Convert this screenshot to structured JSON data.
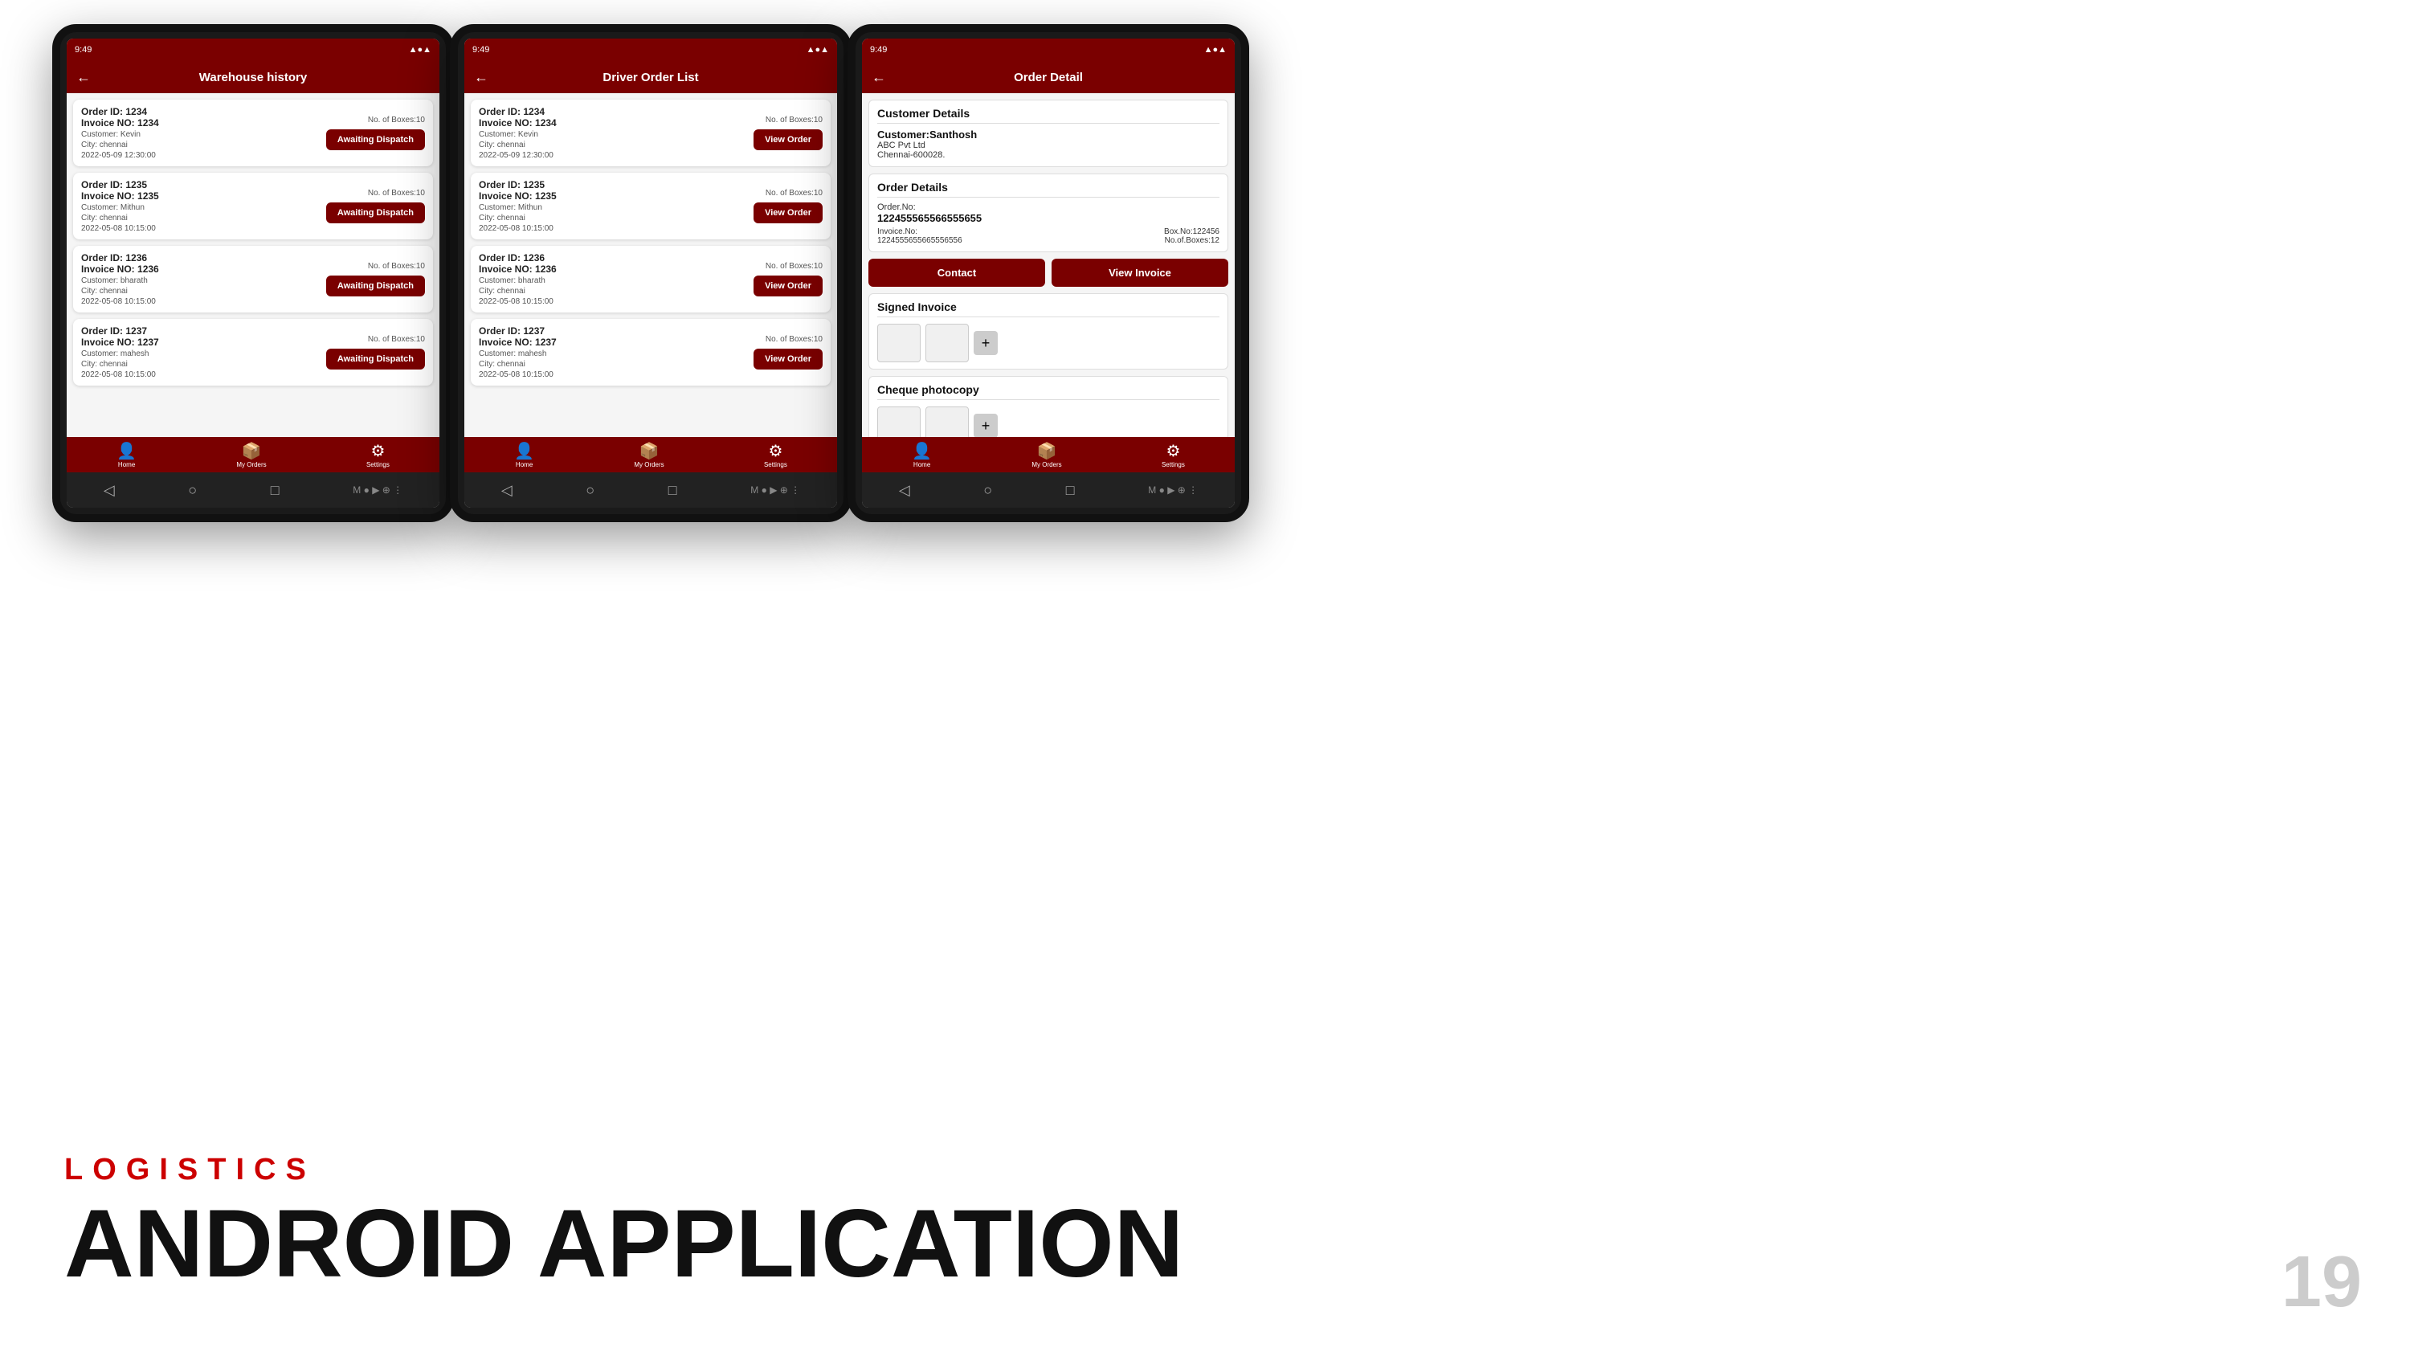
{
  "page": {
    "title": "LOGISTICS",
    "subtitle": "ANDROID APPLICATION",
    "page_number": "19"
  },
  "tablet1": {
    "header_title": "Warehouse history",
    "status_time": "9:49",
    "orders": [
      {
        "order_id": "Order ID: 1234",
        "invoice_no": "Invoice NO: 1234",
        "customer": "Customer: Kevin",
        "city": "City: chennai",
        "date": "2022-05-09 12:30:00",
        "boxes": "No. of Boxes:10",
        "btn_label": "Awaiting Dispatch"
      },
      {
        "order_id": "Order ID: 1235",
        "invoice_no": "Invoice NO: 1235",
        "customer": "Customer: Mithun",
        "city": "City: chennai",
        "date": "2022-05-08 10:15:00",
        "boxes": "No. of Boxes:10",
        "btn_label": "Awaiting Dispatch"
      },
      {
        "order_id": "Order ID: 1236",
        "invoice_no": "Invoice NO: 1236",
        "customer": "Customer: bharath",
        "city": "City: chennai",
        "date": "2022-05-08 10:15:00",
        "boxes": "No. of Boxes:10",
        "btn_label": "Awaiting Dispatch"
      },
      {
        "order_id": "Order ID: 1237",
        "invoice_no": "Invoice NO: 1237",
        "customer": "Customer: mahesh",
        "city": "City: chennai",
        "date": "2022-05-08 10:15:00",
        "boxes": "No. of Boxes:10",
        "btn_label": "Awaiting Dispatch"
      }
    ],
    "nav": [
      {
        "label": "Home",
        "icon": "👤"
      },
      {
        "label": "My Orders",
        "icon": "📦"
      },
      {
        "label": "Settings",
        "icon": "⚙"
      }
    ]
  },
  "tablet2": {
    "header_title": "Driver Order List",
    "status_time": "9:49",
    "orders": [
      {
        "order_id": "Order ID: 1234",
        "invoice_no": "Invoice NO: 1234",
        "customer": "Customer: Kevin",
        "city": "City: chennai",
        "date": "2022-05-09 12:30:00",
        "boxes": "No. of Boxes:10",
        "btn_label": "View Order"
      },
      {
        "order_id": "Order ID: 1235",
        "invoice_no": "Invoice NO: 1235",
        "customer": "Customer: Mithun",
        "city": "City: chennai",
        "date": "2022-05-08 10:15:00",
        "boxes": "No. of Boxes:10",
        "btn_label": "View Order"
      },
      {
        "order_id": "Order ID: 1236",
        "invoice_no": "Invoice NO: 1236",
        "customer": "Customer: bharath",
        "city": "City: chennai",
        "date": "2022-05-08 10:15:00",
        "boxes": "No. of Boxes:10",
        "btn_label": "View Order"
      },
      {
        "order_id": "Order ID: 1237",
        "invoice_no": "Invoice NO: 1237",
        "customer": "Customer: mahesh",
        "city": "City: chennai",
        "date": "2022-05-08 10:15:00",
        "boxes": "No. of Boxes:10",
        "btn_label": "View Order"
      }
    ],
    "nav": [
      {
        "label": "Home",
        "icon": "👤"
      },
      {
        "label": "My Orders",
        "icon": "📦"
      },
      {
        "label": "Settings",
        "icon": "⚙"
      }
    ]
  },
  "tablet3": {
    "header_title": "Order Detail",
    "status_time": "9:49",
    "customer_details_title": "Customer Details",
    "customer_name": "Customer:Santhosh",
    "company": "ABC Pvt Ltd",
    "address": "Chennai-600028.",
    "order_details_title": "Order Details",
    "order_no_label": "Order.No:",
    "order_no": "122455565566555655",
    "invoice_no_label": "Invoice.No:",
    "invoice_no": "1224555655665556556",
    "box_no_label": "Box.No:",
    "box_no": "122456",
    "boxes_label": "No.of.Boxes:",
    "boxes_count": "12",
    "btn_contact": "Contact",
    "btn_view_invoice": "View Invoice",
    "signed_invoice_title": "Signed Invoice",
    "cheque_photocopy_title": "Cheque photocopy",
    "add_icon": "+",
    "nav": [
      {
        "label": "Home",
        "icon": "👤"
      },
      {
        "label": "My Orders",
        "icon": "📦"
      },
      {
        "label": "Settings",
        "icon": "⚙"
      }
    ]
  }
}
